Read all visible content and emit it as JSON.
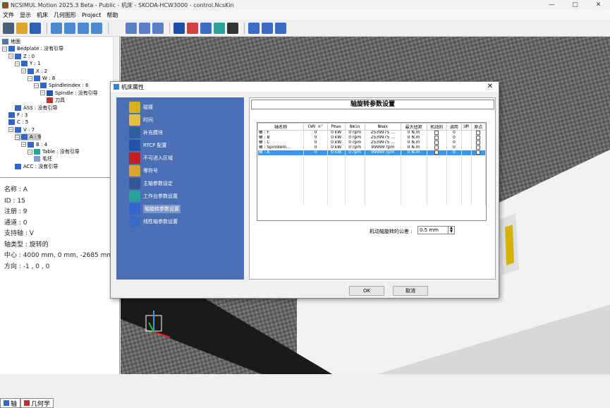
{
  "app": {
    "title": "NCSIMUL Motion 2025.3 Beta - Public - 机床 - SKODA-HCW3000 - control.NcsKin",
    "winbtns": [
      "—",
      "▢",
      "✕"
    ]
  },
  "menu": [
    "文件",
    "显示",
    "机床",
    "几何图形",
    "Project",
    "帮助"
  ],
  "toolbar": {
    "colors": [
      "#4a5d7a",
      "#d9a52b",
      "#2f5fb3",
      "#4a8ad1",
      "#4a8ad1",
      "#4a8ad1",
      "#4a8ad1",
      "#f0f0f0",
      "#5b7ec7",
      "#5b7ec7",
      "#5b7ec7",
      "#1c4fa8",
      "#d04040",
      "#3b6cc4",
      "#2aa19b",
      "#333333",
      "#3b6cc4",
      "#3b6cc4",
      "#3b6cc4"
    ]
  },
  "tree": [
    {
      "indent": 0,
      "exp": "",
      "icon": "#5577aa",
      "label": "地面"
    },
    {
      "indent": 0,
      "exp": "−",
      "icon": "#3366cc",
      "label": "Bedplate : 没有引导"
    },
    {
      "indent": 1,
      "exp": "−",
      "icon": "#3366cc",
      "label": "Z : 0"
    },
    {
      "indent": 2,
      "exp": "−",
      "icon": "#3366cc",
      "label": "Y : 1"
    },
    {
      "indent": 3,
      "exp": "−",
      "icon": "#3366cc",
      "label": "X : 2"
    },
    {
      "indent": 4,
      "exp": "−",
      "icon": "#3366cc",
      "label": "W : 8"
    },
    {
      "indent": 5,
      "exp": "−",
      "icon": "#3366cc",
      "label": "SpindleIndex : 6"
    },
    {
      "indent": 6,
      "exp": "−",
      "icon": "#2255aa",
      "label": "Spindle : 没有引导"
    },
    {
      "indent": 7,
      "exp": "",
      "icon": "#c03030",
      "label": "刀具"
    },
    {
      "indent": 2,
      "exp": "",
      "icon": "#3366cc",
      "label": "ASS : 没有引导"
    },
    {
      "indent": 1,
      "exp": "",
      "icon": "#3366cc",
      "label": "F : 3"
    },
    {
      "indent": 1,
      "exp": "",
      "icon": "#3366cc",
      "label": "C : 5"
    },
    {
      "indent": 1,
      "exp": "−",
      "icon": "#3366cc",
      "label": "V : 7"
    },
    {
      "indent": 2,
      "exp": "−",
      "icon": "#3366cc",
      "label": "A : 9",
      "sel": true
    },
    {
      "indent": 3,
      "exp": "−",
      "icon": "#3366cc",
      "label": "B : 4"
    },
    {
      "indent": 4,
      "exp": "−",
      "icon": "#2aa19b",
      "label": "Table : 没有引导"
    },
    {
      "indent": 5,
      "exp": "",
      "icon": "#8899cc",
      "label": "毛坯"
    },
    {
      "indent": 2,
      "exp": "",
      "icon": "#3366cc",
      "label": "ACC : 没有引导"
    }
  ],
  "props": [
    "名称 : A",
    "ID : 15",
    "注册 : 9",
    "通道 : 0",
    "支持轴 : V",
    "轴类型 : 旋转的",
    "中心 : 4000 mm, 0 mm, -2685 mm",
    "方向 : -1 , 0 , 0"
  ],
  "bottomtabs": [
    {
      "label": "轴",
      "color": "#3366cc"
    },
    {
      "label": "几何学",
      "color": "#c03030"
    }
  ],
  "dialog": {
    "title": "机床属性",
    "close": "✕",
    "nav": [
      {
        "label": "碰撞",
        "color": "#d9b020"
      },
      {
        "label": "时间",
        "color": "#e8c040"
      },
      {
        "label": "补充模块",
        "color": "#2a5fa0"
      },
      {
        "label": "RTCP 配置",
        "color": "#2255aa"
      },
      {
        "label": "不可进入区域",
        "color": "#c02020"
      },
      {
        "label": "零符号",
        "color": "#d9a52b"
      },
      {
        "label": "主轴参数设定",
        "color": "#335599"
      },
      {
        "label": "工作台参数设置",
        "color": "#2aa19b"
      },
      {
        "label": "轴旋转参数设置",
        "color": "#3366cc",
        "active": true
      },
      {
        "label": "线性轴参数设置",
        "color": "#3b6cc4"
      }
    ],
    "section_title": "轴旋转参数设置",
    "table": {
      "headers": [
        "轴名称",
        "CWV n°",
        "Pmax",
        "Nmin",
        "Nmax",
        "最大扭矩",
        "机动的",
        "调用",
        "UM",
        "原点"
      ],
      "rows": [
        {
          "name": "轴 : F",
          "cwv": "0",
          "pmax": "0 kW",
          "nmin": "0 rpm",
          "nmax": "2539975 ...",
          "torque": "0 N.m",
          "motor": false,
          "call": "0",
          "um": "",
          "origin": false
        },
        {
          "name": "轴 : B",
          "cwv": "0",
          "pmax": "0 kW",
          "nmin": "0 rpm",
          "nmax": "2539975 ...",
          "torque": "0 N.m",
          "motor": false,
          "call": "0",
          "um": "",
          "origin": true
        },
        {
          "name": "轴 : C",
          "cwv": "0",
          "pmax": "0 kW",
          "nmin": "0 rpm",
          "nmax": "2539975 ...",
          "torque": "0 N.m",
          "motor": false,
          "call": "0",
          "um": "",
          "origin": false
        },
        {
          "name": "轴 : SpindleIn...",
          "cwv": "0",
          "pmax": "0 kW",
          "nmin": "0 rpm",
          "nmax": "99999 rpm",
          "torque": "0 N.m",
          "motor": false,
          "call": "0",
          "um": "",
          "origin": false
        },
        {
          "name": "轴 : A",
          "cwv": "0",
          "pmax": "0 kW",
          "nmin": "0 rpm",
          "nmax": "99999 rpm",
          "torque": "0 N.m",
          "motor": false,
          "call": "0",
          "um": "",
          "origin": false,
          "sel": true
        }
      ]
    },
    "tolerance_label": "机动轴旋转的公差 :",
    "tolerance_value": "0.5 mm",
    "ok": "OK",
    "cancel": "取消"
  }
}
